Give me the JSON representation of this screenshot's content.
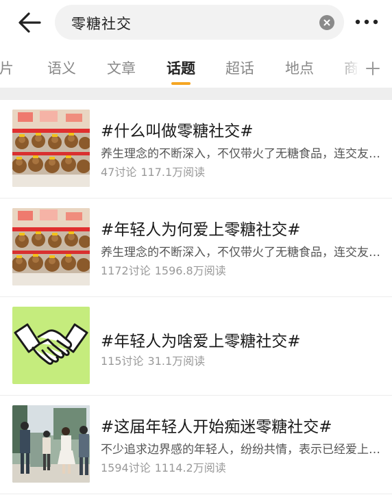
{
  "search": {
    "query": "零糖社交"
  },
  "tabs": [
    {
      "label": "图片",
      "active": false
    },
    {
      "label": "语义",
      "active": false
    },
    {
      "label": "文章",
      "active": false
    },
    {
      "label": "话题",
      "active": true
    },
    {
      "label": "超话",
      "active": false
    },
    {
      "label": "地点",
      "active": false
    },
    {
      "label": "商品",
      "active": false
    }
  ],
  "colors": {
    "accent": "#f5a623",
    "background": "#ffffff",
    "separator": "#eeeeee"
  },
  "topics": [
    {
      "title": "#什么叫做零糖社交#",
      "desc": "养生理念的不断深入，不仅带火了无糖食品，连交友都开始讲究零糖了",
      "discussions": "47讨论",
      "reads": "117.1万阅读",
      "thumb": "plush-toys"
    },
    {
      "title": "#年轻人为何爱上零糖社交#",
      "desc": "养生理念的不断深入，不仅带火了无糖食品，连交友都开始讲究零糖了",
      "discussions": "1172讨论",
      "reads": "1596.8万阅读",
      "thumb": "plush-toys"
    },
    {
      "title": "#年轻人为啥爱上零糖社交#",
      "desc": "",
      "discussions": "115讨论",
      "reads": "31.1万阅读",
      "thumb": "handshake"
    },
    {
      "title": "#这届年轻人开始痴迷零糖社交#",
      "desc": "不少追求边界感的年轻人，纷纷共情，表示已经爱上这种零糖社交",
      "discussions": "1594讨论",
      "reads": "1114.2万阅读",
      "thumb": "people-photo"
    }
  ]
}
